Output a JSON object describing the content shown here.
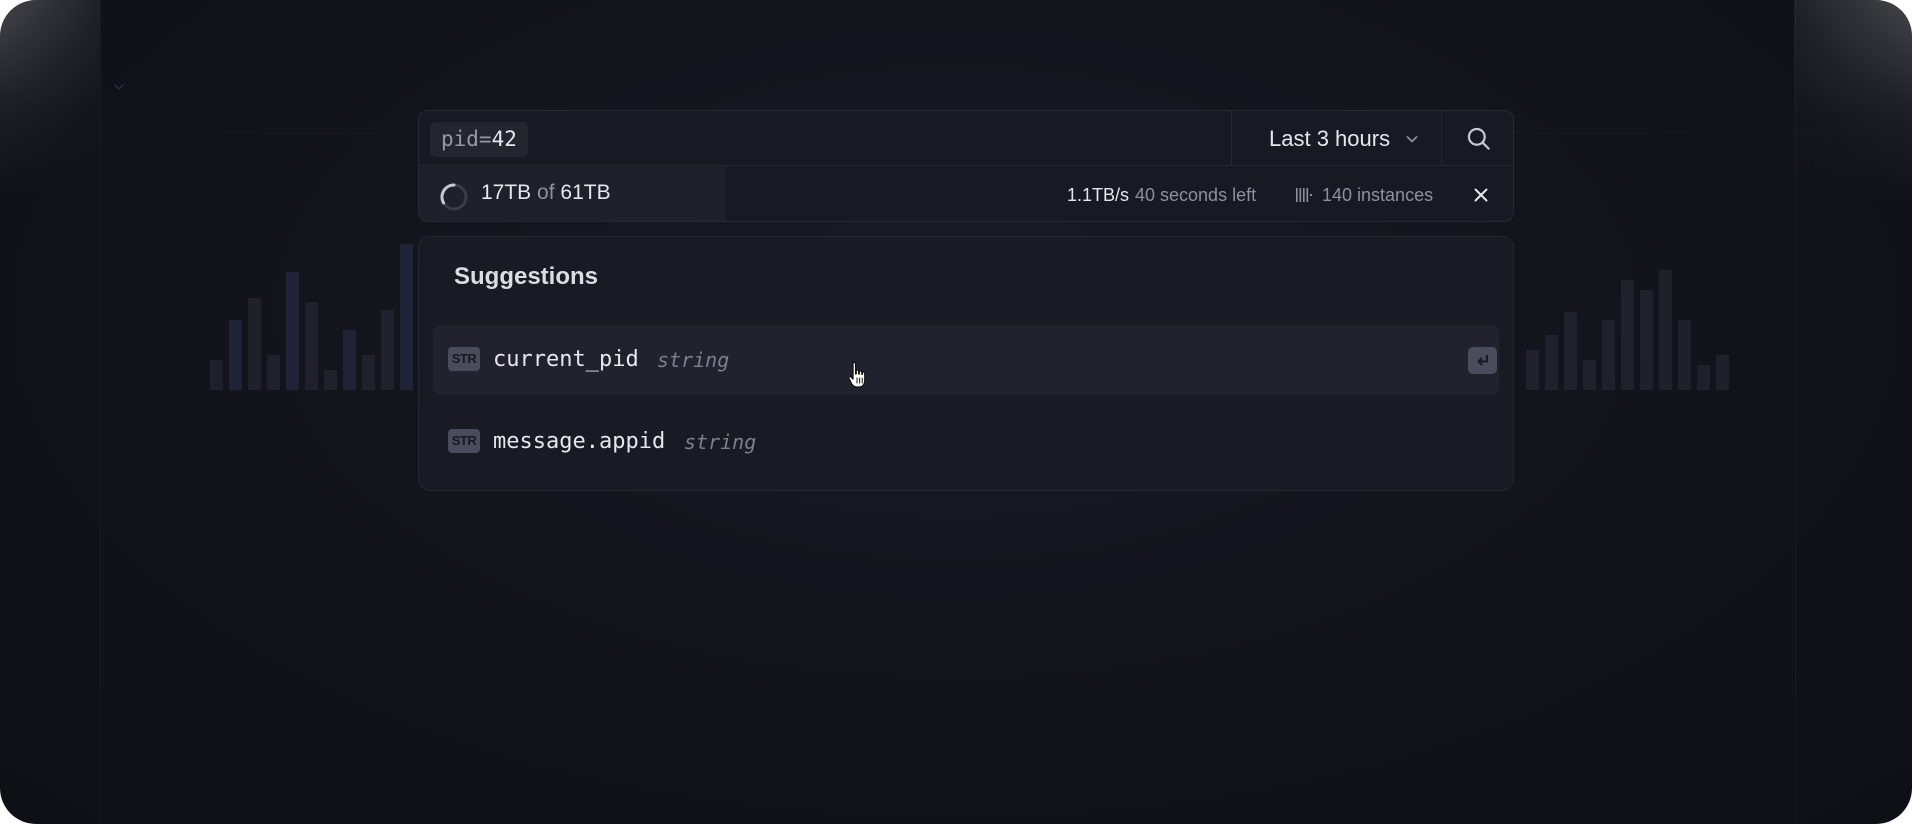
{
  "search": {
    "query_key": "pid=",
    "query_value": "42",
    "time_range": "Last 3 hours"
  },
  "progress": {
    "scanned": "17TB",
    "of_label": "of",
    "total": "61TB",
    "fraction": 0.28,
    "rate": "1.1TB/s",
    "remaining": "40 seconds left",
    "instances": "140 instances"
  },
  "suggestions": {
    "title": "Suggestions",
    "items": [
      {
        "badge": "STR",
        "name": "current_pid",
        "type": "string",
        "active": true
      },
      {
        "badge": "STR",
        "name": "message.appid",
        "type": "string",
        "active": false
      }
    ]
  },
  "icons": {
    "search": "search-icon",
    "chevron": "chevron-down-icon",
    "spinner": "spinner-icon",
    "instances": "instances-icon",
    "close": "close-icon",
    "enter": "enter-key-icon",
    "cursor": "hand-pointer-icon"
  },
  "colors": {
    "background": "#13141c",
    "panel": "#181923",
    "accent_text": "#e6e7ec",
    "muted_text": "#8e90a0"
  }
}
